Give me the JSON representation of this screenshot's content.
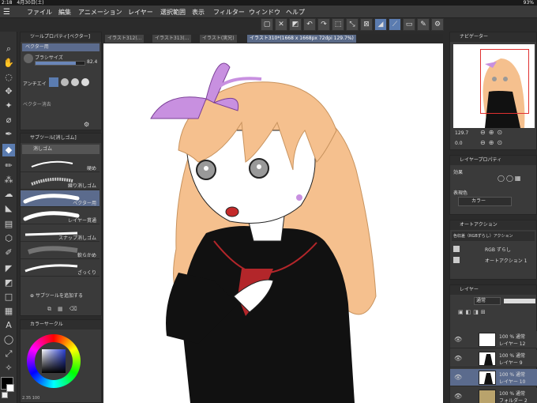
{
  "status": {
    "time": "2:18",
    "date": "4月30日(土)",
    "battery": "93%"
  },
  "menu": [
    "ファイル",
    "編集",
    "アニメーション",
    "レイヤー",
    "選択範囲",
    "表示",
    "フィルター",
    "ウィンドウ",
    "ヘルプ"
  ],
  "tool_property": {
    "title": "ツールプロパティ[ベクター]",
    "tool": "ベクター用",
    "brush_size_label": "ブラシサイズ",
    "brush_size_value": "82.4",
    "antialias_label": "アンチエイ",
    "vector_label": "ベクター消去"
  },
  "sub_tool": {
    "title": "サブツール[消しゴム]",
    "group": "消しゴム",
    "items": [
      "硬め",
      "練り消しゴム",
      "ベクター用",
      "レイヤー貫通",
      "スナップ消しゴム",
      "軟らかめ",
      "ざっくり"
    ],
    "add_label": "サブツールを追加する"
  },
  "color_panel": {
    "title": "カラーサークル",
    "size_readout": "2.35",
    "opacity_readout": "100"
  },
  "doc_tabs": [
    "イラスト312(...",
    "イラスト313(...",
    "イラスト(実兄)",
    "イラスト310*(1668 x 1668px 72dpi 129.7%)"
  ],
  "navigator": {
    "title": "ナビゲーター",
    "zoom": "129.7",
    "angle": "0.0"
  },
  "layer_property": {
    "title": "レイヤープロパティ",
    "effect_label": "効果",
    "express_label": "表現色",
    "express_value": "カラー"
  },
  "auto_action": {
    "title": "オートアクション",
    "set_name": "色収差（RGBずらし）アクション",
    "item1": "RGB ずらし",
    "item2": "オートアクション 1"
  },
  "layers": {
    "title": "レイヤー",
    "blend": "通常",
    "opacity": "100",
    "rows": [
      {
        "line1": "100 % 通常",
        "line2": "レイヤー 12"
      },
      {
        "line1": "100 % 通常",
        "line2": "レイヤー 9"
      },
      {
        "line1": "100 % 通常",
        "line2": "レイヤー 10"
      },
      {
        "line1": "100 % 通常",
        "line2": "フォルダー 2"
      }
    ]
  },
  "colors": {
    "accent": "#5b7cb0",
    "panel": "#3a3a3a",
    "hair": "#f5c08e",
    "ribbon": "#c890e0",
    "uniform": "#111111",
    "scarf": "#b3262a"
  }
}
